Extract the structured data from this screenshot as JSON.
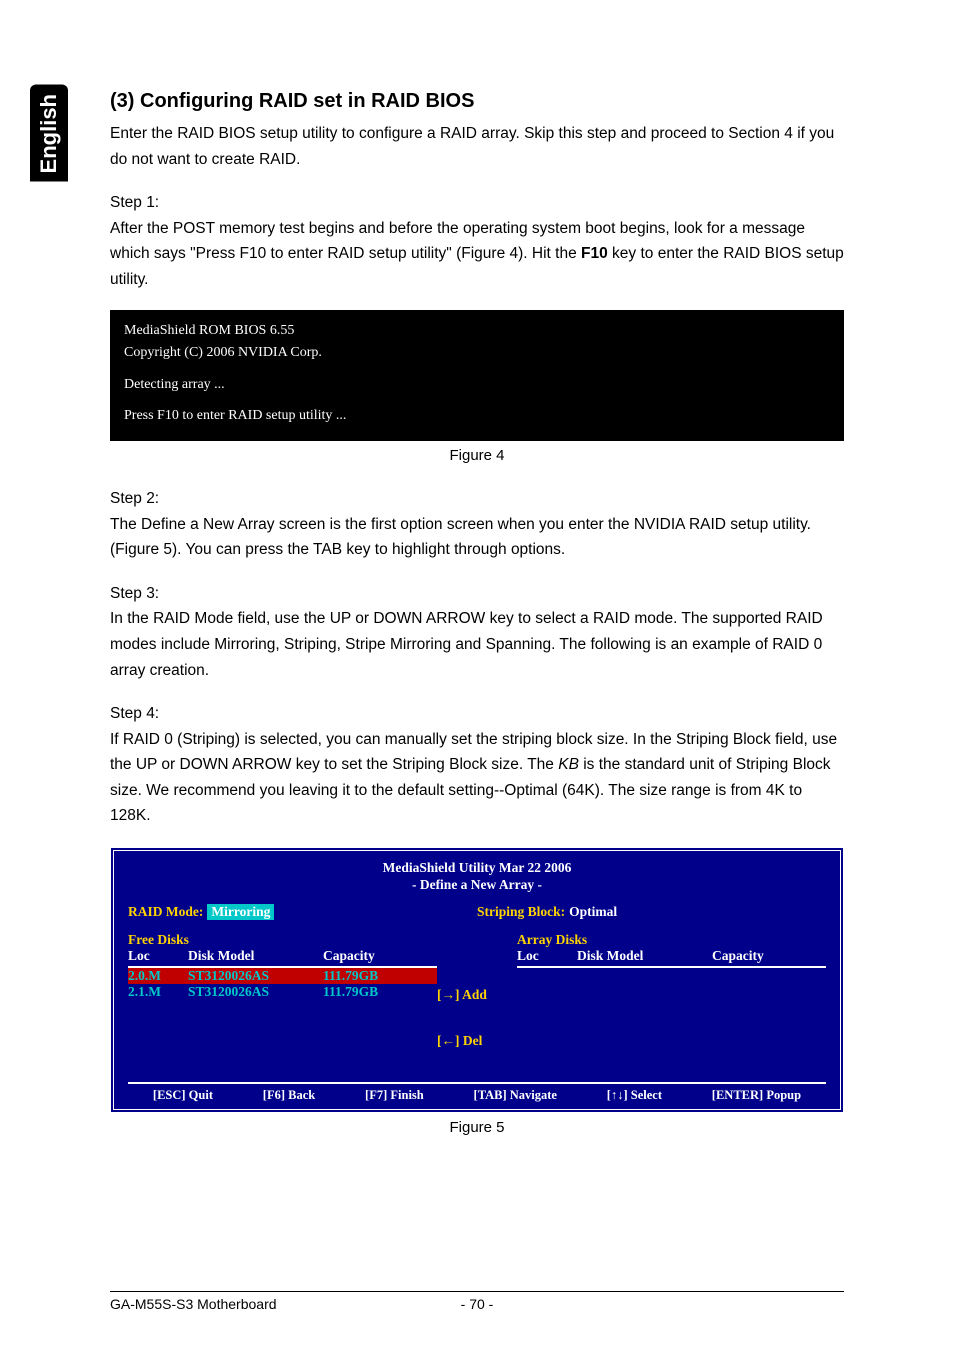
{
  "language_tab": "English",
  "section": {
    "title": "(3) Configuring RAID set in RAID BIOS",
    "intro": "Enter the RAID BIOS setup utility to configure a RAID array. Skip this step and proceed to Section 4 if you do not want to create RAID."
  },
  "step1": {
    "label": "Step 1:",
    "text_a": "After the POST memory test begins and before the operating system boot begins, look for a message which says \"Press F10 to enter RAID setup utility\" (Figure 4). Hit the ",
    "key": "F10",
    "text_b": " key to enter the RAID BIOS setup utility."
  },
  "console": {
    "line1": "MediaShield ROM BIOS 6.55",
    "line2": "Copyright (C) 2006 NVIDIA Corp.",
    "line3": "Detecting array ...",
    "line4": "Press F10 to enter RAID setup utility ..."
  },
  "fig4_caption": "Figure 4",
  "step2": {
    "label": "Step 2:",
    "text": "The Define a New Array screen is the first option screen when you enter the NVIDIA RAID setup utility. (Figure 5). You can press the TAB key to highlight through options."
  },
  "step3": {
    "label": "Step 3:",
    "text": "In the RAID Mode field, use the UP or DOWN ARROW key to select a RAID mode. The supported RAID modes include Mirroring, Striping, Stripe Mirroring and Spanning. The following is an example of RAID 0 array creation."
  },
  "step4": {
    "label": "Step 4:",
    "text_a": "If RAID 0 (Striping) is selected, you can manually set the striping block size. In the Striping Block field, use the UP or DOWN ARROW key to set the Striping Block size. The ",
    "kb": "KB",
    "text_b": " is the standard unit of Striping Block size.  We recommend you leaving it to the default setting--Optimal (64K). The size range is from 4K to 128K."
  },
  "bios": {
    "title1": "MediaShield Utility  Mar  22 2006",
    "title2": "- Define a New Array -",
    "raid_mode_label": "RAID Mode:",
    "raid_mode_value": "Mirroring",
    "striping_label": "Striping Block:",
    "striping_value": "Optimal",
    "free_disks_label": "Free Disks",
    "array_disks_label": "Array Disks",
    "col_loc": "Loc",
    "col_model": "Disk Model",
    "col_cap": "Capacity",
    "rows": [
      {
        "loc": "2.0.M",
        "model": "ST3120026AS",
        "cap": "111.79GB",
        "selected": true
      },
      {
        "loc": "2.1.M",
        "model": "ST3120026AS",
        "cap": "111.79GB",
        "selected": false
      }
    ],
    "add_label": "[→] Add",
    "del_label": "[←] Del",
    "footer": {
      "quit": "[ESC] Quit",
      "back": "[F6] Back",
      "finish": "[F7] Finish",
      "navigate": "[TAB] Navigate",
      "select": "[↑↓] Select",
      "popup": "[ENTER] Popup"
    }
  },
  "fig5_caption": "Figure 5",
  "footer": {
    "left": "GA-M55S-S3 Motherboard",
    "center": "- 70 -"
  }
}
